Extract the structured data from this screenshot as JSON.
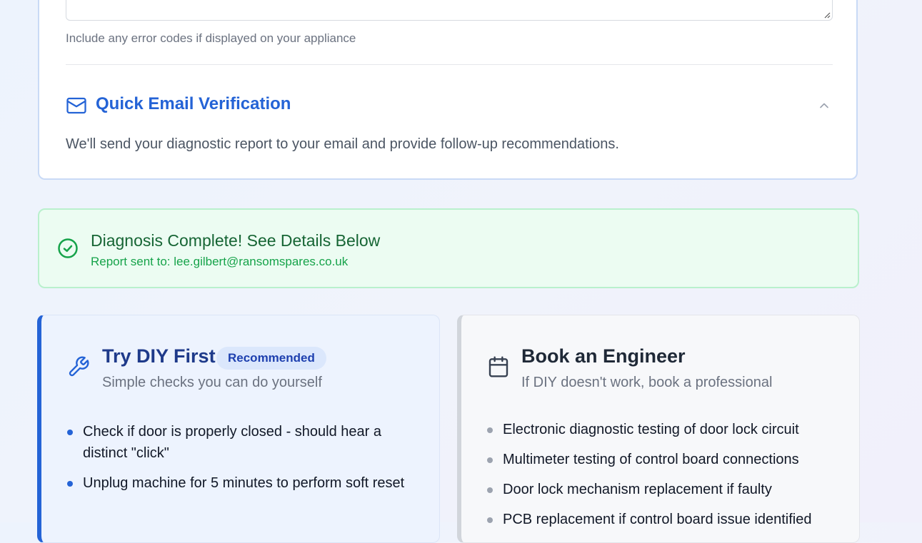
{
  "form": {
    "hint": "Include any error codes if displayed on your appliance",
    "email_section": {
      "icon": "mail-icon",
      "title": "Quick Email Verification",
      "description": "We'll send your diagnostic report to your email and provide follow-up recommendations."
    }
  },
  "success": {
    "title": "Diagnosis Complete! See Details Below",
    "sent_to": "Report sent to: lee.gilbert@ransomspares.co.uk"
  },
  "diy": {
    "icon": "wrench-icon",
    "title": "Try DIY First",
    "badge": "Recommended",
    "subtitle": "Simple checks you can do yourself",
    "items": [
      "Check if door is properly closed - should hear a distinct \"click\"",
      "Unplug machine for 5 minutes to perform soft reset"
    ]
  },
  "engineer": {
    "icon": "calendar-icon",
    "title": "Book an Engineer",
    "subtitle": "If DIY doesn't work, book a professional",
    "items": [
      "Electronic diagnostic testing of door lock circuit",
      "Multimeter testing of control board connections",
      "Door lock mechanism replacement if faulty",
      "PCB replacement if control board issue identified"
    ]
  },
  "colors": {
    "accent": "#2463d6",
    "success_text": "#166534",
    "success_bg": "#ecfcf2",
    "diy_border": "#2463d6",
    "engineer_border": "#d1d5db"
  }
}
